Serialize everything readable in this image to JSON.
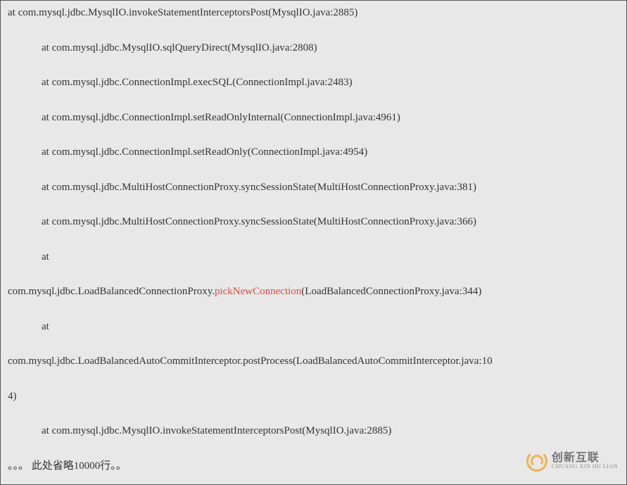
{
  "stack": {
    "lines": [
      {
        "indent": 0,
        "text": "at com.mysql.jdbc.MysqlIO.invokeStatementInterceptorsPost(MysqlIO.java:2885)"
      },
      {
        "indent": 1,
        "text": "at com.mysql.jdbc.MysqlIO.sqlQueryDirect(MysqlIO.java:2808)"
      },
      {
        "indent": 1,
        "text": "at com.mysql.jdbc.ConnectionImpl.execSQL(ConnectionImpl.java:2483)"
      },
      {
        "indent": 1,
        "text": "at com.mysql.jdbc.ConnectionImpl.setReadOnlyInternal(ConnectionImpl.java:4961)"
      },
      {
        "indent": 1,
        "text": "at com.mysql.jdbc.ConnectionImpl.setReadOnly(ConnectionImpl.java:4954)"
      },
      {
        "indent": 1,
        "text": "at com.mysql.jdbc.MultiHostConnectionProxy.syncSessionState(MultiHostConnectionProxy.java:381)"
      },
      {
        "indent": 1,
        "text": "at com.mysql.jdbc.MultiHostConnectionProxy.syncSessionState(MultiHostConnectionProxy.java:366)"
      },
      {
        "indent": 1,
        "text": "at"
      },
      {
        "indent": 0,
        "type": "highlight",
        "pre": "com.mysql.jdbc.LoadBalancedConnectionProxy.",
        "hl": "pickNewConnection",
        "post": "(LoadBalancedConnectionProxy.java:344)"
      },
      {
        "indent": 1,
        "text": "at"
      },
      {
        "indent": 0,
        "text": "com.mysql.jdbc.LoadBalancedAutoCommitInterceptor.postProcess(LoadBalancedAutoCommitInterceptor.java:10"
      },
      {
        "indent": 0,
        "text": "4)"
      },
      {
        "indent": 1,
        "text": "at com.mysql.jdbc.MysqlIO.invokeStatementInterceptorsPost(MysqlIO.java:2885)"
      },
      {
        "indent": 0,
        "text": "。。。 此处省略10000行。。"
      }
    ]
  },
  "watermark": {
    "main": "创新互联",
    "sub": "CHUANG XIN HU LIAN"
  }
}
